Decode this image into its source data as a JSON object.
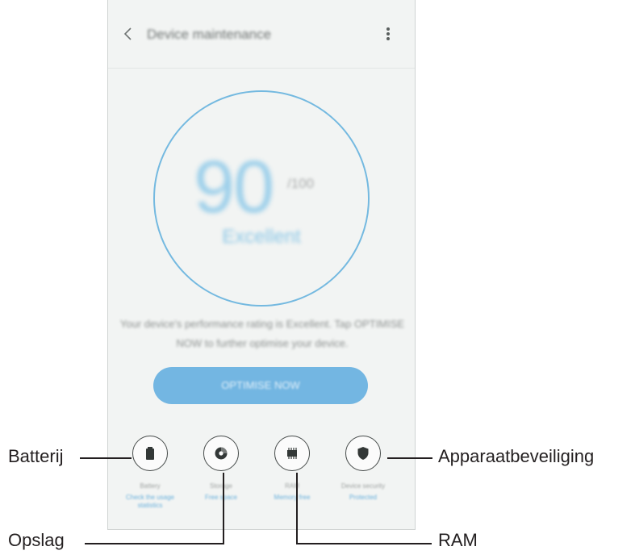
{
  "screen": {
    "title": "Device maintenance",
    "score": "90",
    "score_max": "/100",
    "score_label": "Excellent",
    "description": "Your device's performance rating is Excellent. Tap OPTIMISE NOW to further optimise your device.",
    "optimize_label": "OPTIMISE NOW"
  },
  "features": [
    {
      "label": "Battery",
      "value": "Check the usage statistics",
      "icon": "battery-icon"
    },
    {
      "label": "Storage",
      "value": "Free space",
      "icon": "storage-icon"
    },
    {
      "label": "RAM",
      "value": "Memory free",
      "icon": "ram-icon"
    },
    {
      "label": "Device security",
      "value": "Protected",
      "icon": "shield-icon"
    }
  ],
  "callouts": {
    "battery": "Batterij",
    "storage": "Opslag",
    "ram": "RAM",
    "security": "Apparaatbeveiliging"
  },
  "colors": {
    "accent": "#73b6e2",
    "ring": "#74b9e0",
    "background": "#f2f4f3"
  }
}
